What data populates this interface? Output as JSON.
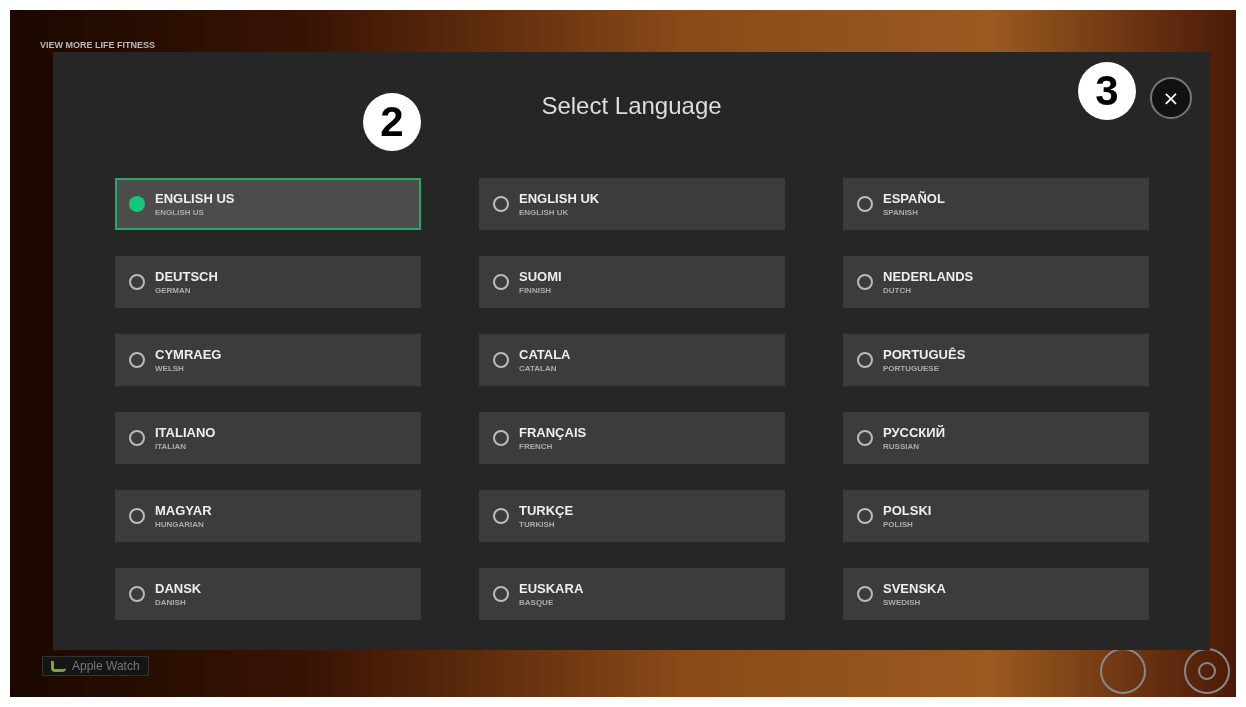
{
  "background": {
    "promo_text": "VIEW MORE LIFE FITNESS",
    "devices": [
      {
        "label": "Apple Watch"
      }
    ]
  },
  "dialog": {
    "title": "Select Language",
    "close_label": "×",
    "languages": [
      {
        "name": "ENGLISH US",
        "english": "ENGLISH US",
        "selected": true
      },
      {
        "name": "ENGLISH UK",
        "english": "ENGLISH UK",
        "selected": false
      },
      {
        "name": "ESPAÑOL",
        "english": "SPANISH",
        "selected": false
      },
      {
        "name": "DEUTSCH",
        "english": "GERMAN",
        "selected": false
      },
      {
        "name": "SUOMI",
        "english": "FINNISH",
        "selected": false
      },
      {
        "name": "NEDERLANDS",
        "english": "DUTCH",
        "selected": false
      },
      {
        "name": "CYMRAEG",
        "english": "WELSH",
        "selected": false
      },
      {
        "name": "CATALA",
        "english": "CATALAN",
        "selected": false
      },
      {
        "name": "PORTUGUÊS",
        "english": "PORTUGUESE",
        "selected": false
      },
      {
        "name": "ITALIANO",
        "english": "ITALIAN",
        "selected": false
      },
      {
        "name": "FRANÇAIS",
        "english": "FRENCH",
        "selected": false
      },
      {
        "name": "РУССКИЙ",
        "english": "RUSSIAN",
        "selected": false
      },
      {
        "name": "MAGYAR",
        "english": "HUNGARIAN",
        "selected": false
      },
      {
        "name": "TURKÇE",
        "english": "TURKISH",
        "selected": false
      },
      {
        "name": "POLSKI",
        "english": "POLISH",
        "selected": false
      },
      {
        "name": "DANSK",
        "english": "DANISH",
        "selected": false
      },
      {
        "name": "EUSKARA",
        "english": "BASQUE",
        "selected": false
      },
      {
        "name": "SVENSKA",
        "english": "SWEDISH",
        "selected": false
      }
    ]
  },
  "callouts": [
    {
      "label": "2"
    },
    {
      "label": "3"
    }
  ]
}
